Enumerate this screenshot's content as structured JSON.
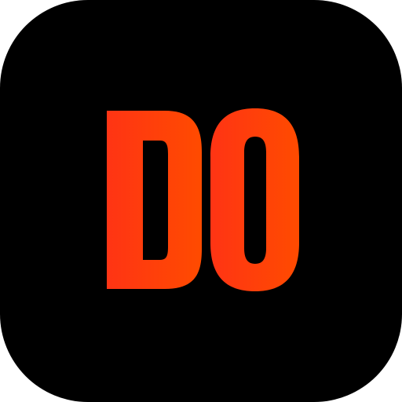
{
  "app_icon": {
    "logo_text": "DO",
    "background_color": "#000000",
    "gradient_start_color": "#ff3414",
    "gradient_end_color": "#ff4b00"
  }
}
